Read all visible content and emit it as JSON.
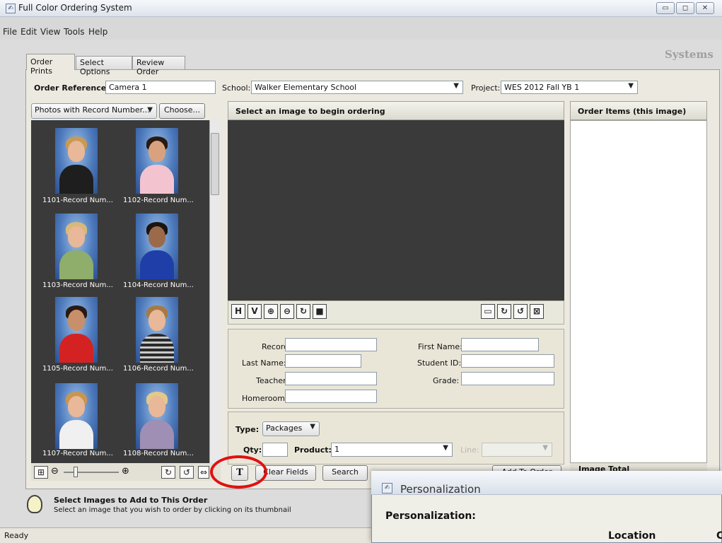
{
  "window": {
    "title": "Full Color Ordering System",
    "minimize": "▭",
    "maximize": "◻",
    "close": "✕"
  },
  "menu": [
    "File",
    "Edit",
    "View",
    "Tools",
    "Help"
  ],
  "brand": "Systems",
  "tabs": [
    "Order Prints",
    "Select Options",
    "Review Order"
  ],
  "top_fields": {
    "order_reference_label": "Order Reference:",
    "order_reference_value": "Camera 1",
    "school_label": "School:",
    "school_value": "Walker Elementary School",
    "project_label": "Project:",
    "project_value": "WES 2012 Fall YB 1"
  },
  "photo_filter": {
    "value": "Photos with Record Number...",
    "choose_label": "Choose..."
  },
  "thumbnails": [
    "1101-Record Num...",
    "1102-Record Num...",
    "1103-Record Num...",
    "1104-Record Num...",
    "1105-Record Num...",
    "1106-Record Num...",
    "1107-Record Num...",
    "1108-Record Num..."
  ],
  "viewer": {
    "header": "Select an image to begin ordering"
  },
  "order_items": {
    "header": "Order Items (this image)",
    "image_total": "Image Total"
  },
  "fields": {
    "record": "Record:",
    "first_name": "First Name:",
    "last_name": "Last Name:",
    "student_id": "Student ID:",
    "teacher": "Teacher:",
    "grade": "Grade:",
    "homeroom": "Homeroom:"
  },
  "order": {
    "type_label": "Type:",
    "type_value": "Packages",
    "qty_label": "Qty:",
    "product_label": "Product:",
    "product_value": "1",
    "line_label": "Line:"
  },
  "buttons": {
    "text_tool": "T",
    "clear_fields": "Clear Fields",
    "search": "Search",
    "add_to_order": "Add To Order"
  },
  "hint": {
    "title": "Select Images to Add to This Order",
    "body": "Select an image that you wish to order by clicking on its thumbnail"
  },
  "status": "Ready",
  "dialog": {
    "title": "Personalization",
    "heading": "Personalization:",
    "column": "Location",
    "column2": "C"
  }
}
